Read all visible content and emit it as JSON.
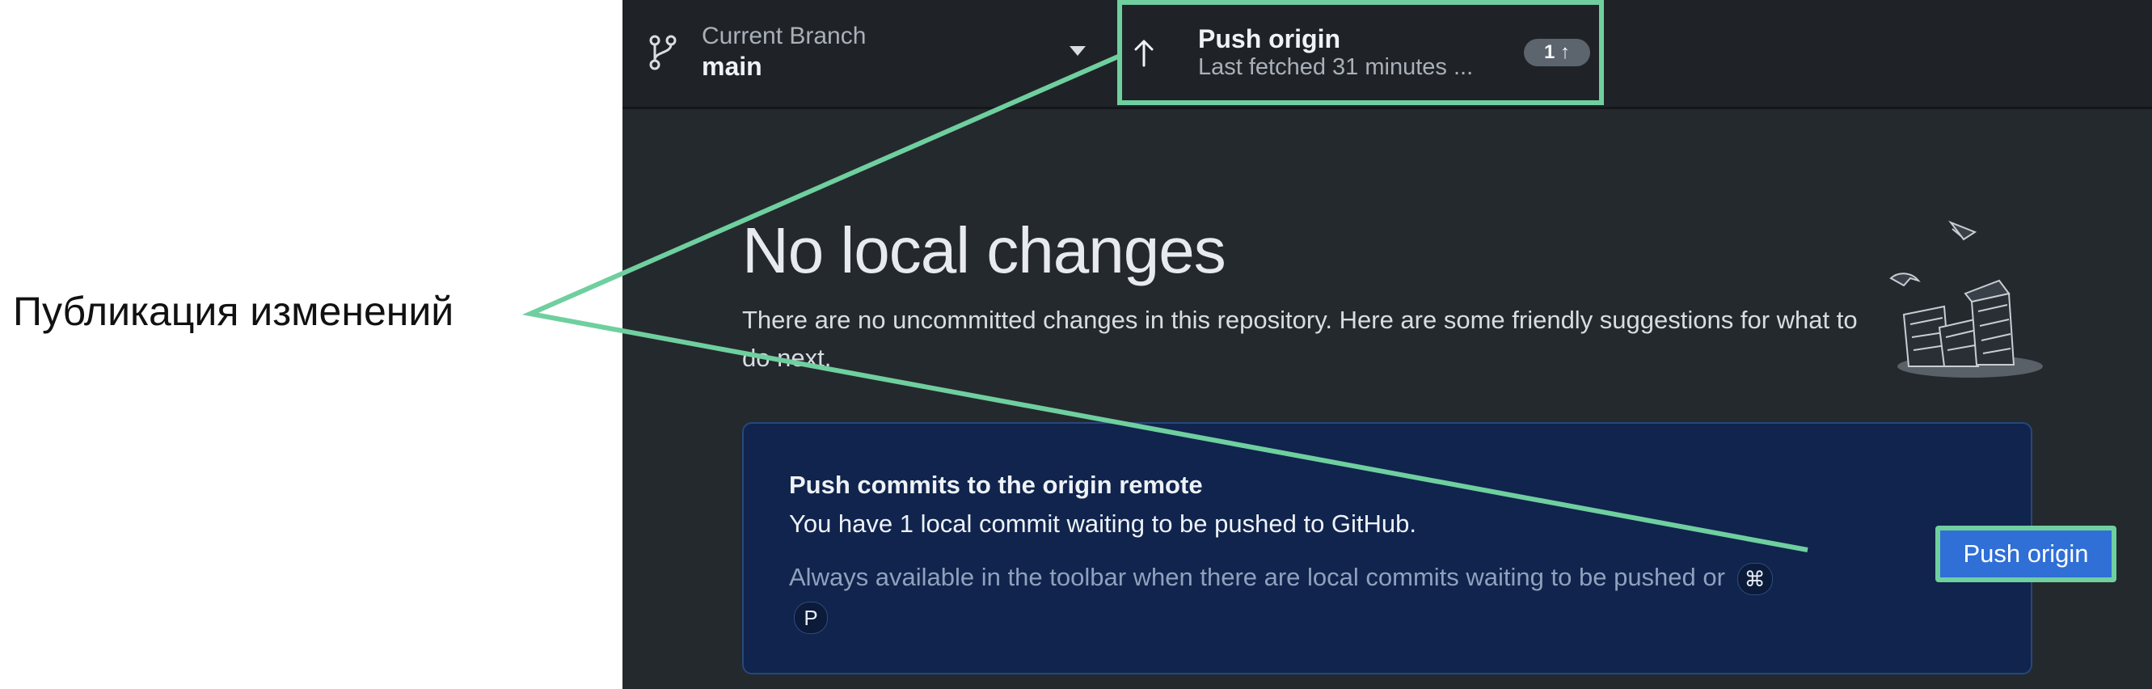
{
  "annotation": {
    "label": "Публикация изменений",
    "highlight_color": "#6fcf9f"
  },
  "toolbar": {
    "branch_icon": "git-branch-icon",
    "branch_caption": "Current Branch",
    "branch_name": "main",
    "push_title": "Push origin",
    "push_subtitle": "Last fetched 31 minutes ...",
    "push_badge": "1 ↑"
  },
  "main": {
    "title": "No local changes",
    "description": "There are no uncommitted changes in this repository. Here are some friendly suggestions for what to do next.",
    "card": {
      "title": "Push commits to the origin remote",
      "message": "You have 1 local commit waiting to be pushed to GitHub.",
      "note": "Always available in the toolbar when there are local commits waiting to be pushed or",
      "shortcut_keys": [
        "⌘",
        "P"
      ],
      "button_label": "Push origin"
    }
  },
  "colors": {
    "app_background": "#24292e",
    "toolbar_background": "#1f2328",
    "card_background": "#10244d",
    "button_background": "#2f6fd6",
    "annotation_green": "#6fcf9f"
  }
}
